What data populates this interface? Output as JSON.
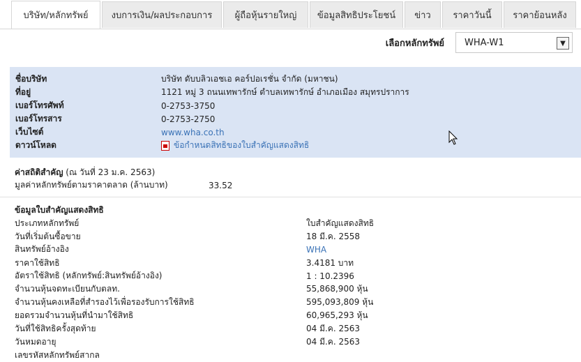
{
  "tabs": [
    {
      "label": "บริษัท/หลักทรัพย์",
      "active": true
    },
    {
      "label": "งบการเงิน/ผลประกอบการ"
    },
    {
      "label": "ผู้ถือหุ้นรายใหญ่"
    },
    {
      "label": "ข้อมูลสิทธิประโยชน์"
    },
    {
      "label": "ข่าว"
    },
    {
      "label": "ราคาวันนี้"
    },
    {
      "label": "ราคาย้อนหลัง"
    }
  ],
  "selector": {
    "label": "เลือกหลักทรัพย์",
    "value": "WHA-W1"
  },
  "company": {
    "name_label": "ชื่อบริษัท",
    "name": "บริษัท ดับบลิวเอชเอ คอร์ปอเรชั่น จำกัด (มหาชน)",
    "address_label": "ที่อยู่",
    "address": "1121 หมู่ 3 ถนนเทพารักษ์ ตำบลเทพารักษ์ อำเภอเมือง สมุทรปราการ",
    "phone_label": "เบอร์โทรศัพท์",
    "phone": "0-2753-3750",
    "fax_label": "เบอร์โทรสาร",
    "fax": "0-2753-2750",
    "website_label": "เว็บไซต์",
    "website": "www.wha.co.th",
    "download_label": "ดาวน์โหลด",
    "download": "ข้อกำหนดสิทธิของใบสำคัญแสดงสิทธิ"
  },
  "stats": {
    "title": "ค่าสถิติสำคัญ",
    "date": "(ณ วันที่ 23 ม.ค. 2563)",
    "market_cap_label": "มูลค่าหลักทรัพย์ตามราคาตลาด (ล้านบาท)",
    "market_cap": "33.52"
  },
  "warrant": {
    "title": "ข้อมูลใบสำคัญแสดงสิทธิ",
    "rows": [
      {
        "label": "ประเภทหลักทรัพย์",
        "value": "ใบสำคัญแสดงสิทธิ"
      },
      {
        "label": "วันที่เริ่มต้นซื้อขาย",
        "value": "18 มี.ค. 2558"
      },
      {
        "label": "สินทรัพย์อ้างอิง",
        "value": "WHA",
        "link": true
      },
      {
        "label": "ราคาใช้สิทธิ",
        "value": "3.4181 บาท"
      },
      {
        "label": "อัตราใช้สิทธิ (หลักทรัพย์:สินทรัพย์อ้างอิง)",
        "value": "1 : 10.2396"
      },
      {
        "label": "จำนวนหุ้นจดทะเบียนกับตลท.",
        "value": "55,868,900 หุ้น"
      },
      {
        "label": "จำนวนหุ้นคงเหลือที่สำรองไว้เพื่อรองรับการใช้สิทธิ",
        "value": "595,093,809 หุ้น"
      },
      {
        "label": "ยอดรวมจำนวนหุ้นที่นำมาใช้สิทธิ",
        "value": "60,965,293 หุ้น"
      },
      {
        "label": "วันที่ใช้สิทธิครั้งสุดท้าย",
        "value": "04 มี.ค. 2563"
      },
      {
        "label": "วันหมดอายุ",
        "value": "04 มี.ค. 2563"
      },
      {
        "label": "เลขรหัสหลักทรัพย์สากล",
        "value": ""
      }
    ]
  }
}
